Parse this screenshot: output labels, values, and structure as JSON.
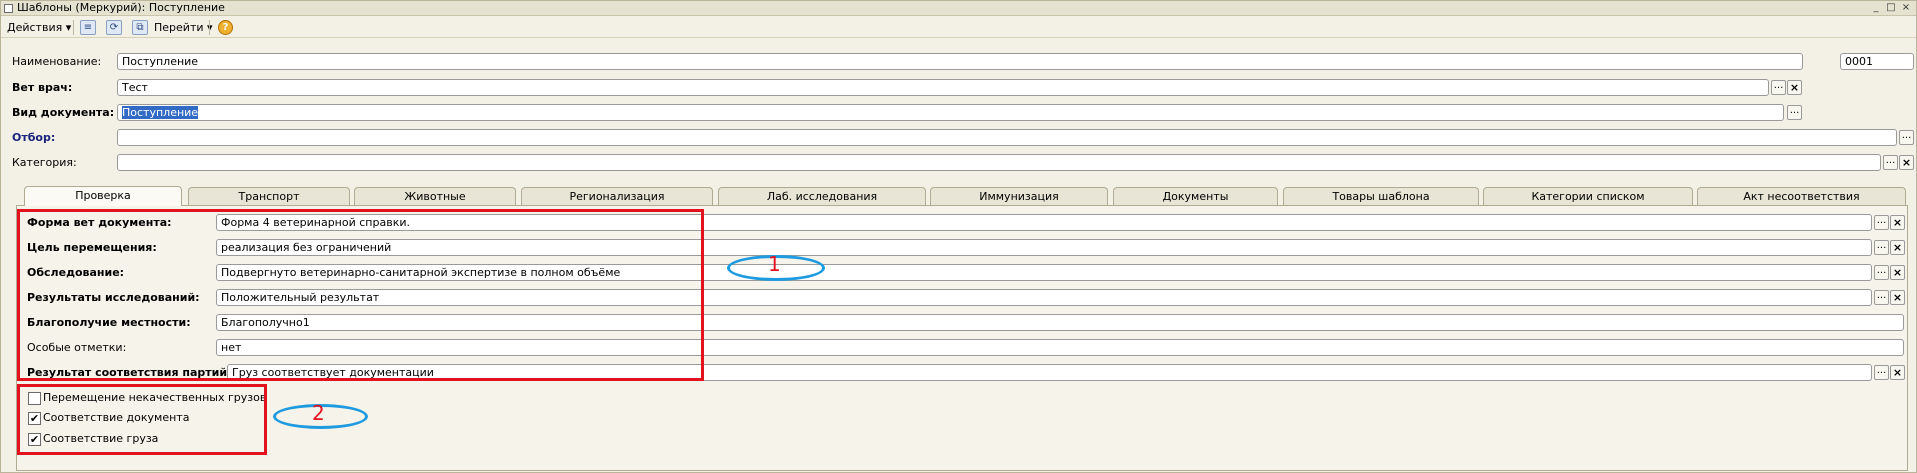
{
  "window": {
    "title": "Шаблоны (Меркурий): Поступление",
    "controls": [
      "_",
      "□",
      "×"
    ]
  },
  "toolbar": {
    "actions_label": "Действия",
    "goto_label": "Перейти",
    "help_label": "?",
    "icons": [
      "list-icon",
      "refresh-icon",
      "copy-icon",
      "help-icon"
    ]
  },
  "header": {
    "name_label": "Наименование:",
    "name_value": "Поступление",
    "code_value": "0001",
    "vet_label": "Вет врач:",
    "vet_value": "Тест",
    "doctype_label": "Вид документа:",
    "doctype_value": "Поступление",
    "filter_label": "Отбор:",
    "filter_value": "",
    "category_label": "Категория:",
    "category_value": ""
  },
  "tabs": [
    {
      "label": "Проверка",
      "active": true
    },
    {
      "label": "Транспорт",
      "active": false
    },
    {
      "label": "Животные",
      "active": false
    },
    {
      "label": "Регионализация",
      "active": false
    },
    {
      "label": "Лаб. исследования",
      "active": false
    },
    {
      "label": "Иммунизация",
      "active": false
    },
    {
      "label": "Документы",
      "active": false
    },
    {
      "label": "Товары шаблона",
      "active": false
    },
    {
      "label": "Категории списком",
      "active": false
    },
    {
      "label": "Акт несоответствия",
      "active": false
    }
  ],
  "form": {
    "rows": [
      {
        "label": "Форма вет документа:",
        "value": "Форма 4 ветеринарной справки.",
        "bold": true
      },
      {
        "label": "Цель перемещения:",
        "value": "реализация без ограничений",
        "bold": true
      },
      {
        "label": "Обследование:",
        "value": "Подвергнуто ветеринарно-санитарной экспертизе в полном объёме",
        "bold": true
      },
      {
        "label": "Результаты исследований:",
        "value": "Положительный результат",
        "bold": true
      },
      {
        "label": "Благополучие местности:",
        "value": "Благополучно1",
        "bold": true
      },
      {
        "label": "Особые отметки:",
        "value": "нет",
        "bold": false
      },
      {
        "label": "Результат соответствия партий:",
        "value": "Груз соответствует документации",
        "bold": true
      }
    ]
  },
  "checkboxes": [
    {
      "label": "Перемещение некачественных грузов",
      "checked": false
    },
    {
      "label": "Соответствие документа",
      "checked": true
    },
    {
      "label": "Соответствие груза",
      "checked": true
    }
  ],
  "annotations": {
    "marker1": "1",
    "marker2": "2",
    "box_color": "#e3121f",
    "ellipse_color": "#1e9be0"
  },
  "glyphs": {
    "dots": "...",
    "clear": "×",
    "check": "✔",
    "dropdown": "▾"
  }
}
